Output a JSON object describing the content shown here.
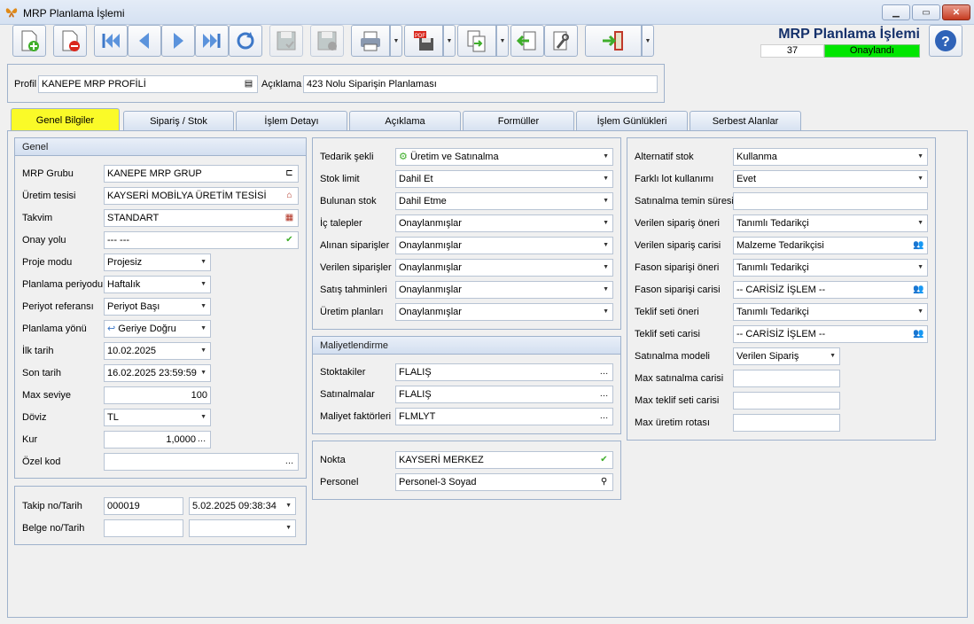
{
  "window": {
    "title": "MRP Planlama İşlemi"
  },
  "header": {
    "title": "MRP Planlama İşlemi",
    "record_no": "37",
    "status": "Onaylandı",
    "status_color": "#00e600"
  },
  "toolbar": {
    "buttons": [
      "new-doc-icon",
      "delete-doc-icon",
      "first-icon",
      "prev-icon",
      "next-icon",
      "last-icon",
      "refresh-icon",
      "save-icon",
      "save-close-icon",
      "print-icon",
      "pdf-icon",
      "export-icon",
      "back-icon",
      "tools-icon",
      "exit-icon"
    ]
  },
  "profile": {
    "profil_label": "Profil",
    "profil_value": "KANEPE MRP PROFİLİ",
    "aciklama_label": "Açıklama",
    "aciklama_value": "423 Nolu Siparişin Planlaması"
  },
  "tabs": [
    {
      "label": "Genel Bilgiler"
    },
    {
      "label": "Sipariş / Stok"
    },
    {
      "label": "İşlem Detayı"
    },
    {
      "label": "Açıklama"
    },
    {
      "label": "Formüller"
    },
    {
      "label": "İşlem Günlükleri"
    },
    {
      "label": "Serbest Alanlar"
    }
  ],
  "genel": {
    "title": "Genel",
    "fields": [
      {
        "label": "MRP Grubu",
        "value": "KANEPE MRP GRUP"
      },
      {
        "label": "Üretim tesisi",
        "value": "KAYSERİ MOBİLYA ÜRETİM TESİSİ"
      },
      {
        "label": "Takvim",
        "value": "STANDART"
      },
      {
        "label": "Onay yolu",
        "value": "--- ---"
      },
      {
        "label": "Proje modu",
        "value": "Projesiz"
      },
      {
        "label": "Planlama periyodu",
        "value": "Haftalık"
      },
      {
        "label": "Periyot referansı",
        "value": "Periyot Başı"
      },
      {
        "label": "Planlama yönü",
        "value": "Geriye Doğru"
      },
      {
        "label": "İlk tarih",
        "value": "10.02.2025"
      },
      {
        "label": "Son tarih",
        "value": "16.02.2025 23:59:59"
      },
      {
        "label": "Max seviye",
        "value": "100"
      },
      {
        "label": "Döviz",
        "value": "TL"
      },
      {
        "label": "Kur",
        "value": "1,0000"
      },
      {
        "label": "Özel kod",
        "value": ""
      }
    ]
  },
  "takip": {
    "takip_label": "Takip no/Tarih",
    "takip_no": "000019",
    "takip_tarih": "5.02.2025 09:38:34",
    "belge_label": "Belge no/Tarih",
    "belge_no": "",
    "belge_tarih": ""
  },
  "middle": {
    "fields": [
      {
        "label": "Tedarik şekli",
        "value": "Üretim ve Satınalma"
      },
      {
        "label": "Stok limit",
        "value": "Dahil Et"
      },
      {
        "label": "Bulunan stok",
        "value": "Dahil Etme"
      },
      {
        "label": "İç talepler",
        "value": "Onaylanmışlar"
      },
      {
        "label": "Alınan siparişler",
        "value": "Onaylanmışlar"
      },
      {
        "label": "Verilen siparişler",
        "value": "Onaylanmışlar"
      },
      {
        "label": "Satış tahminleri",
        "value": "Onaylanmışlar"
      },
      {
        "label": "Üretim planları",
        "value": "Onaylanmışlar"
      }
    ]
  },
  "maliyet": {
    "title": "Maliyetlendirme",
    "fields": [
      {
        "label": "Stoktakiler",
        "value": "FLALIŞ"
      },
      {
        "label": "Satınalmalar",
        "value": "FLALIŞ"
      },
      {
        "label": "Maliyet faktörleri",
        "value": "FLMLYT"
      }
    ]
  },
  "nokta": {
    "nokta_label": "Nokta",
    "nokta_value": "KAYSERİ MERKEZ",
    "personel_label": "Personel",
    "personel_value": "Personel-3 Soyad"
  },
  "right": {
    "fields": [
      {
        "label": "Alternatif stok",
        "value": "Kullanma"
      },
      {
        "label": "Farklı lot kullanımı",
        "value": "Evet"
      },
      {
        "label": "Satınalma temin süresi",
        "value": ""
      },
      {
        "label": "Verilen sipariş öneri",
        "value": "Tanımlı Tedarikçi"
      },
      {
        "label": "Verilen sipariş carisi",
        "value": "Malzeme Tedarikçisi"
      },
      {
        "label": "Fason siparişi öneri",
        "value": "Tanımlı Tedarikçi"
      },
      {
        "label": "Fason siparişi carisi",
        "value": "-- CARİSİZ İŞLEM --"
      },
      {
        "label": "Teklif seti öneri",
        "value": "Tanımlı Tedarikçi"
      },
      {
        "label": "Teklif seti carisi",
        "value": "-- CARİSİZ İŞLEM --"
      },
      {
        "label": "Satınalma modeli",
        "value": "Verilen Sipariş"
      },
      {
        "label": "Max satınalma carisi",
        "value": ""
      },
      {
        "label": "Max teklif seti carisi",
        "value": ""
      },
      {
        "label": "Max üretim rotası",
        "value": ""
      }
    ]
  }
}
